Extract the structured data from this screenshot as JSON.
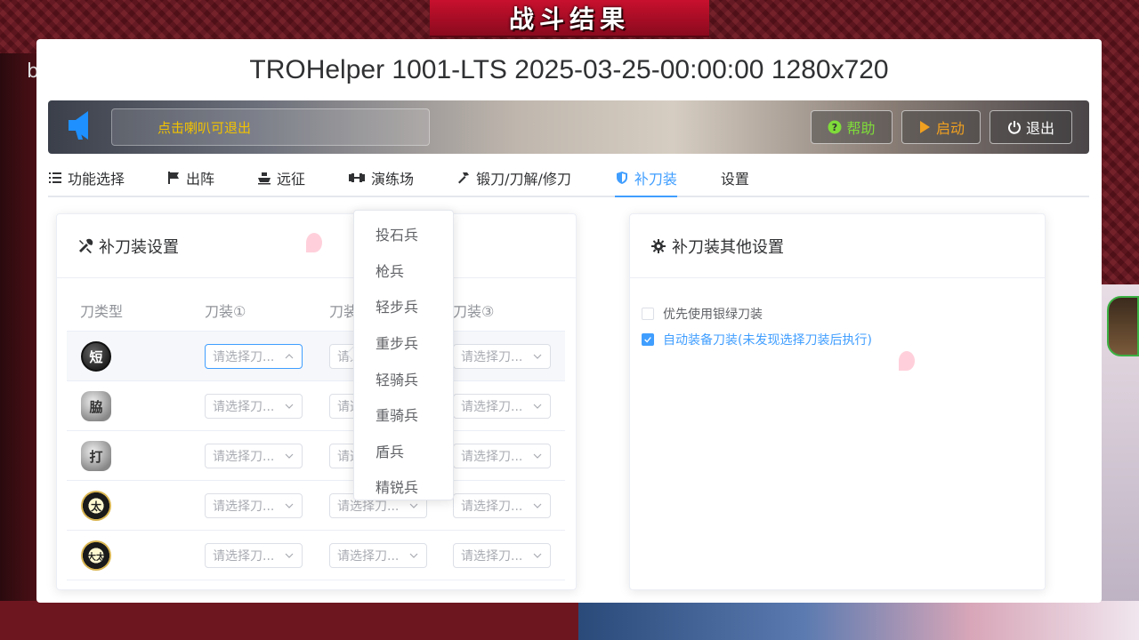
{
  "game": {
    "banner": "战斗结果",
    "left_text": "b"
  },
  "window": {
    "title": "TROHelper 1001-LTS 2025-03-25-00:00:00 1280x720"
  },
  "notice": {
    "text": "点击喇叭可退出"
  },
  "buttons": {
    "help": "帮助",
    "start": "启动",
    "exit": "退出"
  },
  "tabs": [
    {
      "label": "功能选择",
      "icon": "list-icon"
    },
    {
      "label": "出阵",
      "icon": "flag-icon"
    },
    {
      "label": "远征",
      "icon": "ship-icon"
    },
    {
      "label": "演练场",
      "icon": "dumbbell-icon"
    },
    {
      "label": "锻刀/刀解/修刀",
      "icon": "hammer-icon"
    },
    {
      "label": "补刀装",
      "icon": "shield-icon"
    },
    {
      "label": "设置",
      "icon": ""
    }
  ],
  "active_tab": "补刀装",
  "left_card": {
    "title": "补刀装设置",
    "columns": [
      "刀类型",
      "刀装①",
      "刀装②",
      "刀装③"
    ],
    "rows": [
      {
        "type": "短",
        "style": "dark"
      },
      {
        "type": "脇",
        "style": "silver"
      },
      {
        "type": "打",
        "style": "silver"
      },
      {
        "type": "太",
        "style": "gold"
      },
      {
        "type": "大太",
        "style": "gold"
      }
    ],
    "select_placeholder": "请选择刀装",
    "select_placeholder_display": "请选择刀..."
  },
  "dropdown": {
    "options": [
      "投石兵",
      "枪兵",
      "轻步兵",
      "重步兵",
      "轻骑兵",
      "重骑兵",
      "盾兵",
      "精锐兵"
    ]
  },
  "right_card": {
    "title": "补刀装其他设置",
    "options": [
      {
        "label": "优先使用银绿刀装",
        "checked": false
      },
      {
        "label": "自动装备刀装(未发现选择刀装后执行)",
        "checked": true
      }
    ]
  },
  "colors": {
    "accent": "#409eff",
    "help": "#7fdc3a",
    "start": "#f0a020",
    "notice_text": "#f2c200"
  }
}
